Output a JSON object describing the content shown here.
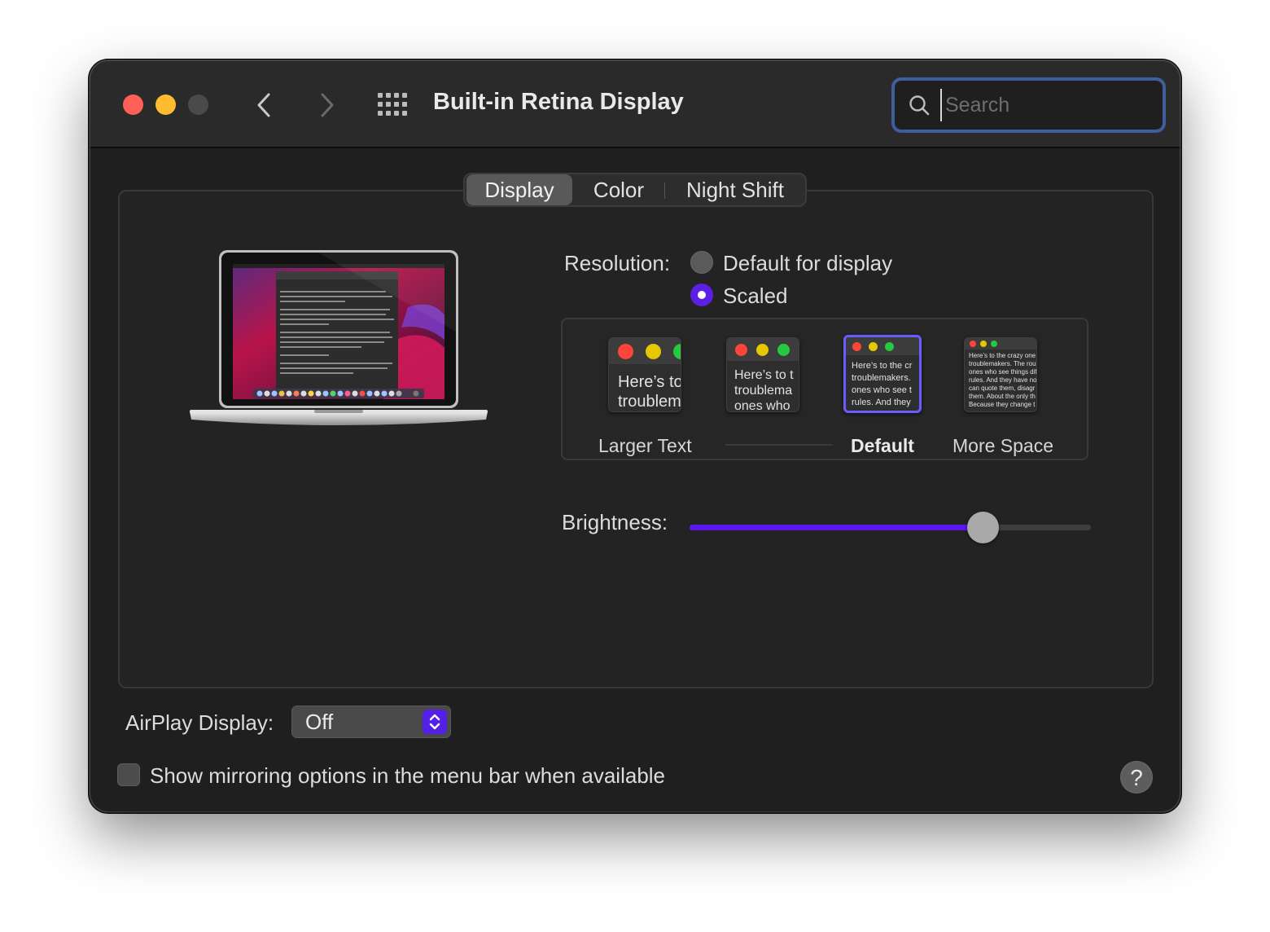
{
  "window": {
    "title": "Built-in Retina Display",
    "search": {
      "placeholder": "Search",
      "value": ""
    }
  },
  "icons": {
    "close": "close-icon",
    "minimize": "minimize-icon",
    "zoom": "zoom-icon",
    "back": "chevron-left-icon",
    "forward": "chevron-right-icon",
    "show_all": "grid-icon",
    "search": "search-icon",
    "popup": "up-down-chevron-icon",
    "help": "question-icon"
  },
  "tabs": [
    {
      "label": "Display",
      "active": true
    },
    {
      "label": "Color",
      "active": false
    },
    {
      "label": "Night Shift",
      "active": false
    }
  ],
  "resolution": {
    "label": "Resolution:",
    "options": [
      {
        "label": "Default for display",
        "selected": false
      },
      {
        "label": "Scaled",
        "selected": true
      }
    ],
    "scaled_choices": [
      {
        "label": "Larger Text",
        "preview": "Here’s to\ntroublem",
        "selected": false
      },
      {
        "label": "",
        "preview": "Here’s to t\ntroublema\nones who",
        "selected": false
      },
      {
        "label": "Default",
        "preview": "Here’s to the cr\ntroublemakers.\nones who see t\nrules. And they",
        "selected": true
      },
      {
        "label": "More Space",
        "preview": "Here’s to the crazy one\ntroublemakers. The rou\nones who see things dif\nrules. And they have no\ncan quote them, disagr\nthem. About the only th\nBecause they change t",
        "selected": false
      }
    ]
  },
  "brightness": {
    "label": "Brightness:",
    "level": 0.731
  },
  "airplay": {
    "label": "AirPlay Display:",
    "value": "Off"
  },
  "mirroring": {
    "label": "Show mirroring options in the menu bar when available",
    "checked": false
  },
  "help": {
    "glyph": "?"
  },
  "colors": {
    "accent": "#5a17f0",
    "close": "#ff5f57",
    "minimize": "#febc2e",
    "search_focus": "#3e5e9c"
  }
}
